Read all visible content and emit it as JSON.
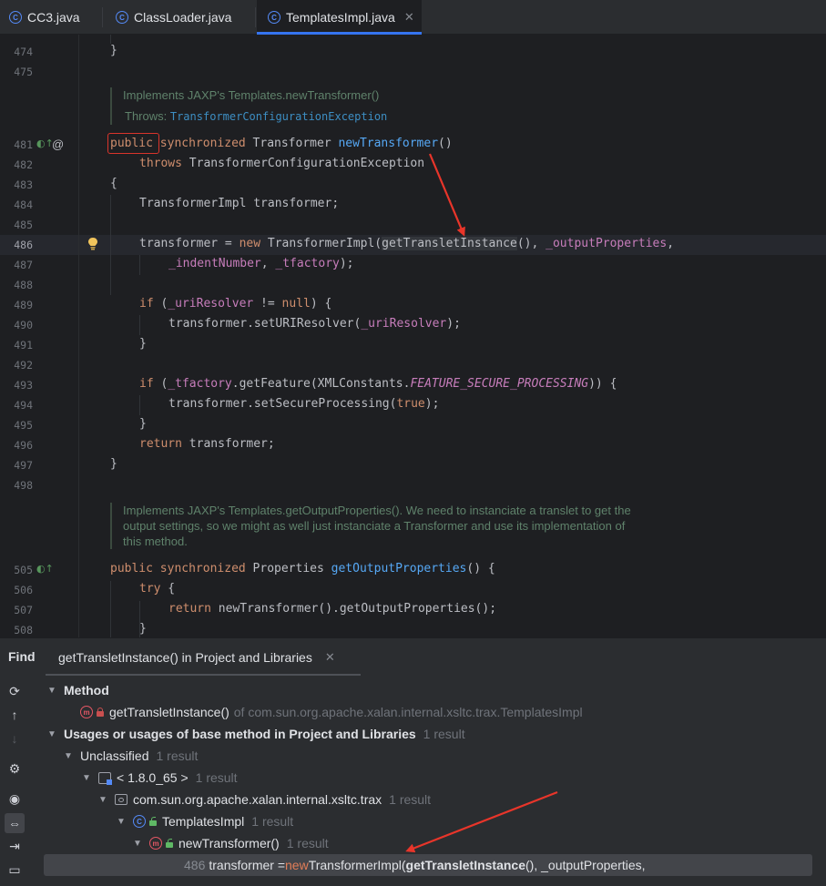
{
  "tabs": [
    {
      "label": "CC3.java",
      "icon": "java-class-icon"
    },
    {
      "label": "ClassLoader.java",
      "icon": "java-class-icon"
    },
    {
      "label": "TemplatesImpl.java",
      "icon": "java-class-icon",
      "active": true
    }
  ],
  "editor": {
    "line_numbers": [
      "474",
      "475",
      "481",
      "482",
      "483",
      "484",
      "485",
      "486",
      "487",
      "488",
      "489",
      "490",
      "491",
      "492",
      "493",
      "494",
      "495",
      "496",
      "497",
      "498",
      "505",
      "506",
      "507",
      "508"
    ],
    "doc1": {
      "text": "Implements JAXP's Templates.newTransformer()",
      "throws_label": "Throws:",
      "throws_link": "TransformerConfigurationException"
    },
    "doc2": {
      "line1": "Implements JAXP's Templates.getOutputProperties(). We need to instanciate a translet to get the",
      "line2": "output settings, so we might as well just instanciate a Transformer and use its implementation of",
      "line3": "this method."
    },
    "code": {
      "l474": "}",
      "l481": {
        "kw1": "public",
        "kw2": "synchronized",
        "type": "Transformer",
        "method": "newTransformer",
        "rest": "()"
      },
      "l482": {
        "kw": "throws",
        "rest": "TransformerConfigurationException"
      },
      "l483": "{",
      "l484": "TransformerImpl transformer;",
      "l486": {
        "a": "transformer = ",
        "kw": "new",
        "b": " TransformerImpl(",
        "c": "getTransletInstance",
        "d": "(), ",
        "f": "_outputProperties",
        "e": ","
      },
      "l487": {
        "f1": "_indentNumber",
        "sep": ", ",
        "f2": "_tfactory",
        "end": ");"
      },
      "l489": {
        "kw": "if",
        "a": " (",
        "f": "_uriResolver",
        "b": " != ",
        "kw2": "null",
        "c": ") {"
      },
      "l490": {
        "a": "transformer.setURIResolver(",
        "f": "_uriResolver",
        "b": ");"
      },
      "l491": "}",
      "l493": {
        "kw": "if",
        "a": " (",
        "f": "_tfactory",
        "b": ".getFeature(XMLConstants.",
        "i": "FEATURE_SECURE_PROCESSING",
        "c": ")) {"
      },
      "l494": {
        "a": "transformer.setSecureProcessing(",
        "kw": "true",
        "b": ");"
      },
      "l495": "}",
      "l496": {
        "kw": "return",
        "rest": " transformer;"
      },
      "l497": "}",
      "l505": {
        "kw1": "public",
        "kw2": "synchronized",
        "type": "Properties",
        "method": "getOutputProperties",
        "rest": "() {"
      },
      "l506": {
        "kw": "try",
        "rest": " {"
      },
      "l507": {
        "kw": "return",
        "rest": " newTransformer().getOutputProperties();"
      },
      "l508": "}"
    }
  },
  "find": {
    "title": "Find",
    "tab_label": "getTransletInstance() in Project and Libraries",
    "tree": {
      "method_header": "Method",
      "method_name": "getTransletInstance()",
      "method_of": "of com.sun.org.apache.xalan.internal.xsltc.trax.TemplatesImpl",
      "usages_header": "Usages or usages of base method in Project and Libraries",
      "usages_count": "1 result",
      "unclassified": "Unclassified",
      "unclassified_count": "1 result",
      "jdk": "< 1.8.0_65 >",
      "jdk_count": "1 result",
      "package": "com.sun.org.apache.xalan.internal.xsltc.trax",
      "package_count": "1 result",
      "class_name": "TemplatesImpl",
      "class_count": "1 result",
      "method_usage": "newTransformer()",
      "method_usage_count": "1 result",
      "result_line_num": "486",
      "result_a": "transformer = ",
      "result_kw": "new",
      "result_b": " TransformerImpl(",
      "result_match": "getTransletInstance",
      "result_c": "(), _outputProperties,"
    }
  },
  "colors": {
    "keyword": "#cf8e6d",
    "method": "#56a8f5",
    "field": "#c77dbb",
    "annotation_arrow": "#e8352a",
    "accent": "#3574f0"
  }
}
